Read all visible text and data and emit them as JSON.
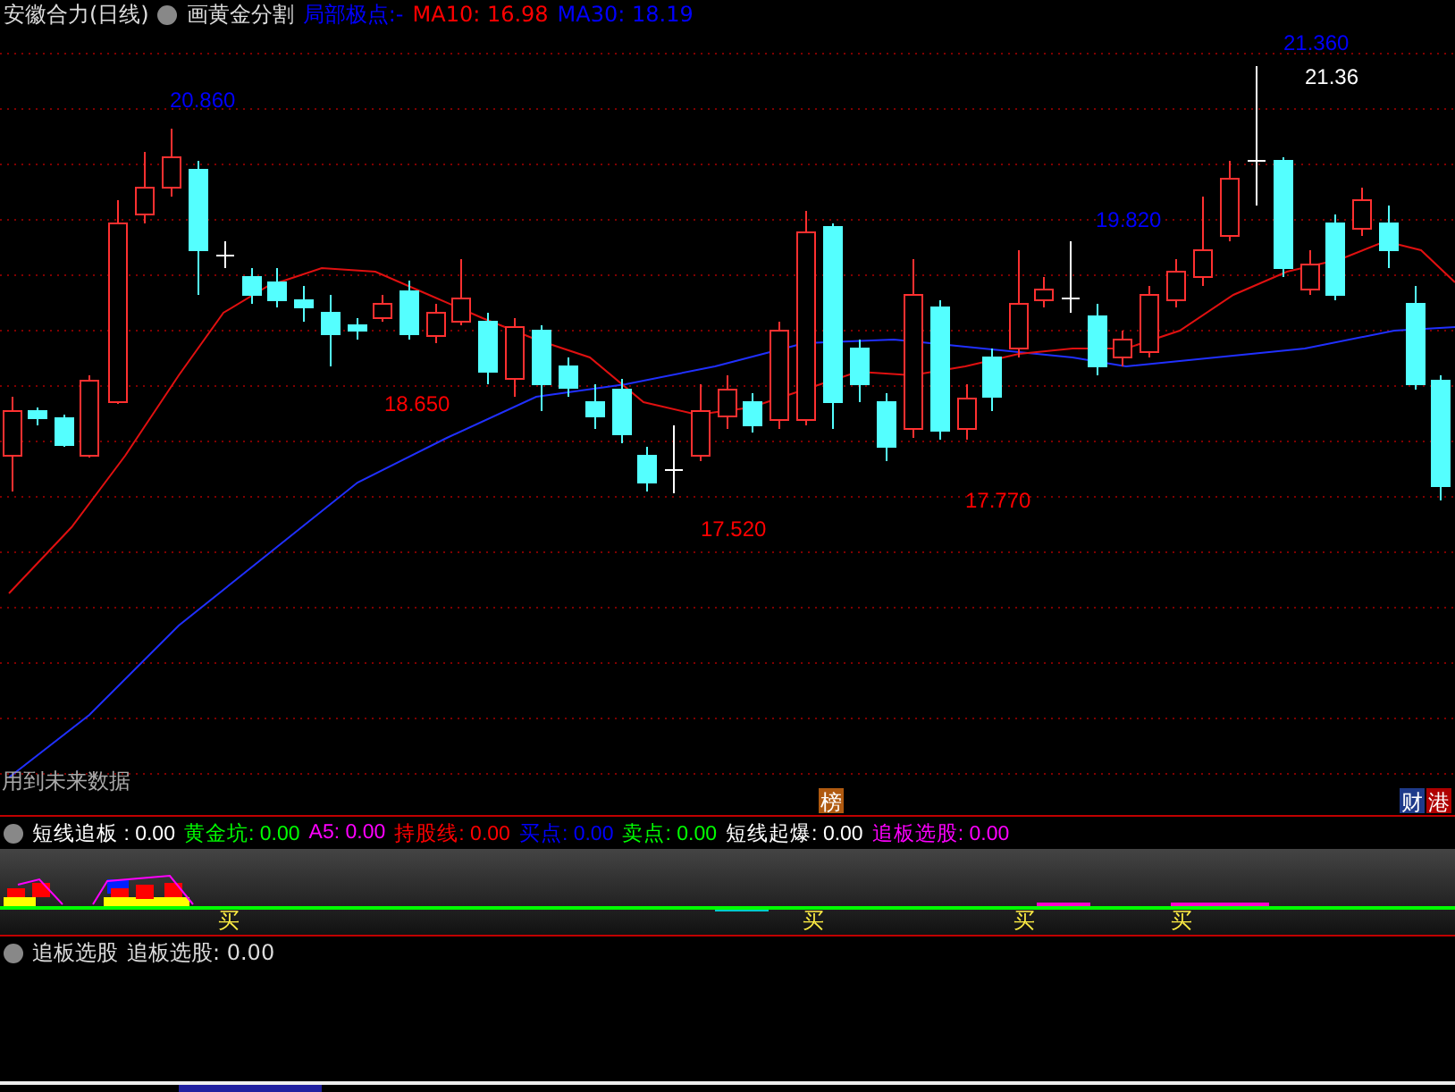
{
  "header": {
    "title": "安徽合力(日线)",
    "indicator": "画黄金分割",
    "values": [
      {
        "text": "局部极点:-",
        "color": "#0000ff"
      },
      {
        "text": "MA10: 16.98",
        "color": "#ff0000"
      },
      {
        "text": "MA30: 18.19",
        "color": "#0000ff"
      }
    ]
  },
  "price_labels": [
    {
      "text": "20.860",
      "color": "#0000ff"
    },
    {
      "text": "18.650",
      "color": "#ff0000"
    },
    {
      "text": "17.520",
      "color": "#ff0000"
    },
    {
      "text": "17.770",
      "color": "#ff0000"
    },
    {
      "text": "19.820",
      "color": "#0000ff"
    },
    {
      "text": "21.360",
      "color": "#0000ff"
    },
    {
      "text": "21.36",
      "color": "#ffffff"
    }
  ],
  "warning": "用到未来数据",
  "badges": [
    {
      "text": "榜",
      "color": "#b05a10"
    },
    {
      "text": "财",
      "color": "#1e3a8a"
    },
    {
      "text": "港",
      "color": "#b00000"
    }
  ],
  "indicator_panel": {
    "items": [
      {
        "label": "短线追板",
        "value": ": 0.00",
        "color": "#ffffff"
      },
      {
        "label": "黄金坑:",
        "value": "0.00",
        "color": "#00ff00"
      },
      {
        "label": "A5:",
        "value": "0.00",
        "color": "#ff00ff"
      },
      {
        "label": "持股线:",
        "value": "0.00",
        "color": "#ff0000"
      },
      {
        "label": "买点:",
        "value": "0.00",
        "color": "#0000ff"
      },
      {
        "label": "卖点:",
        "value": "0.00",
        "color": "#00ff00"
      },
      {
        "label": "短线起爆:",
        "value": "0.00",
        "color": "#ffffff"
      },
      {
        "label": "追板选股:",
        "value": "0.00",
        "color": "#ff00ff"
      }
    ],
    "signals": [
      "买",
      "买",
      "买",
      "买"
    ]
  },
  "bottom_panel": {
    "name": "追板选股",
    "value": "追板选股: 0.00"
  }
}
